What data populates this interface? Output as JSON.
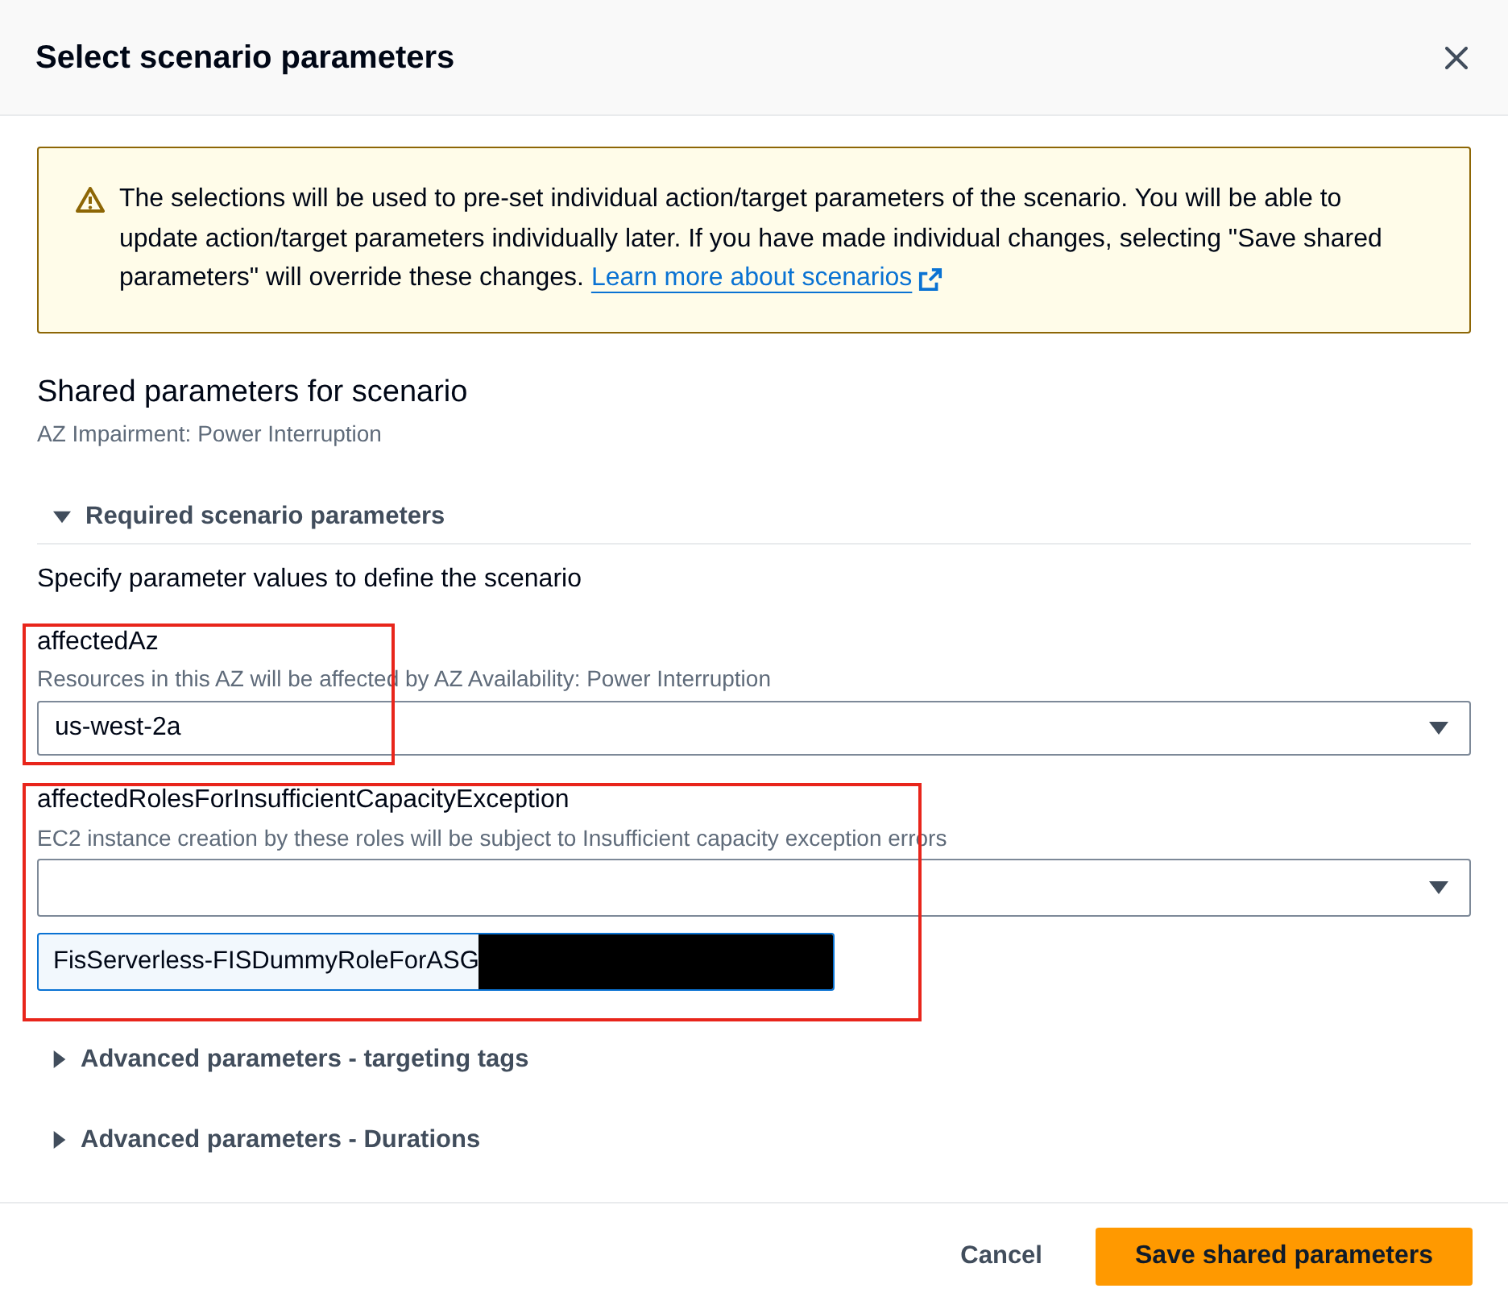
{
  "modal": {
    "title": "Select scenario parameters"
  },
  "alert": {
    "kind": "warning",
    "text": "The selections will be used to pre-set individual action/target parameters of the scenario. You will be able to update action/target parameters individually later. If you have made individual changes, selecting \"Save shared parameters\" will override these changes.",
    "link": "Learn more about scenarios"
  },
  "section": {
    "title": "Shared parameters for scenario",
    "subtitle": "AZ Impairment: Power Interruption"
  },
  "expandables": [
    {
      "label": "Required scenario parameters",
      "expanded": true,
      "description": "Specify parameter values to define the scenario",
      "fields": [
        {
          "label": "affectedAz",
          "description": "Resources in this AZ will be affected by AZ Availability: Power Interruption",
          "value": "us-west-2a",
          "highlighted": true
        },
        {
          "label": "affectedRolesForInsufficientCapacityException",
          "description": "EC2 instance creation by these roles will be subject to Insufficient capacity exception errors",
          "tokens": [
            {
              "label": "FisServerless-FISDummyRoleForASG",
              "redacted": true
            }
          ],
          "highlighted": true
        }
      ]
    },
    {
      "label": "Advanced parameters - targeting tags",
      "expanded": false
    },
    {
      "label": "Advanced parameters - Durations",
      "expanded": false
    }
  ],
  "footer": {
    "buttons": [
      {
        "label": "Cancel",
        "kind": "link"
      },
      {
        "label": "Save shared parameters",
        "kind": "primary"
      }
    ]
  }
}
